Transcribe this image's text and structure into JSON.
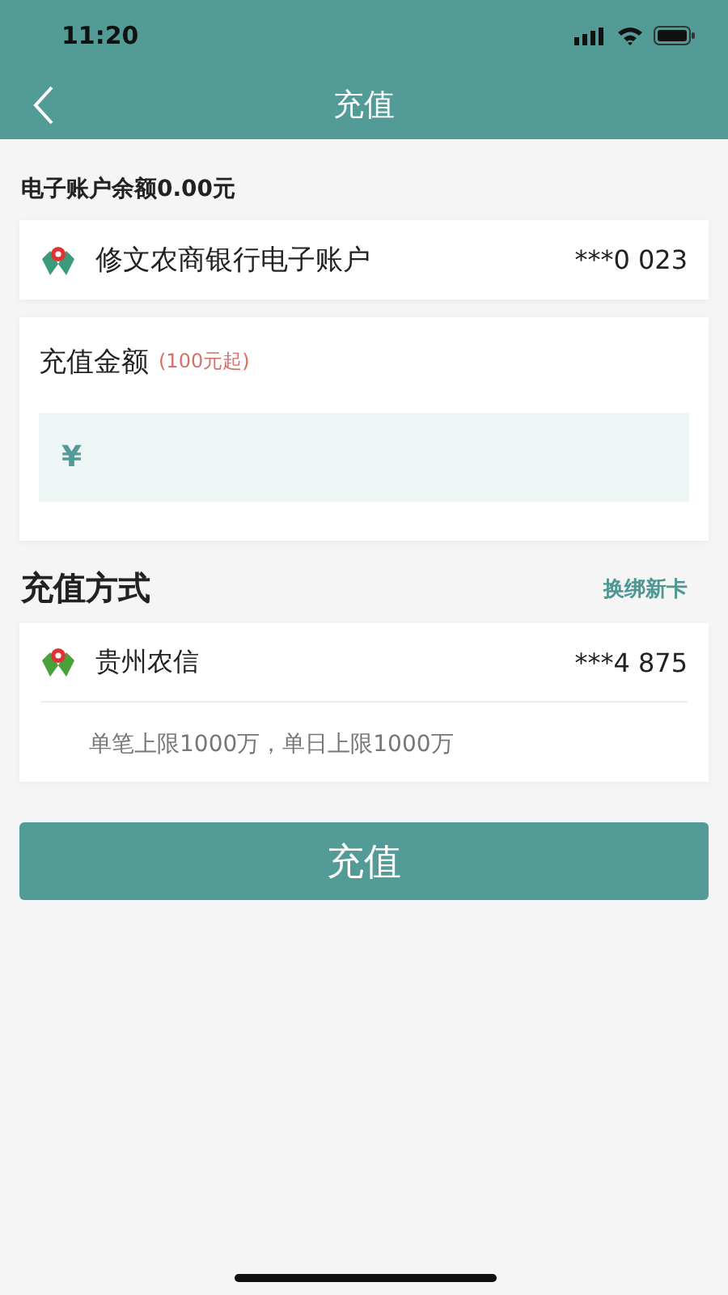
{
  "status_bar": {
    "time": "11:20"
  },
  "nav": {
    "title": "充值"
  },
  "balance": "电子账户余额0.00元",
  "account": {
    "name": "修文农商银行电子账户",
    "number": "***0 023"
  },
  "amount": {
    "label": "充值金额",
    "hint": "(100元起)",
    "currency": "¥"
  },
  "method": {
    "title": "充值方式",
    "link": "换绑新卡",
    "bank": "贵州农信",
    "number": "***4 875",
    "limit": "单笔上限1000万，单日上限1000万"
  },
  "submit": "充值"
}
